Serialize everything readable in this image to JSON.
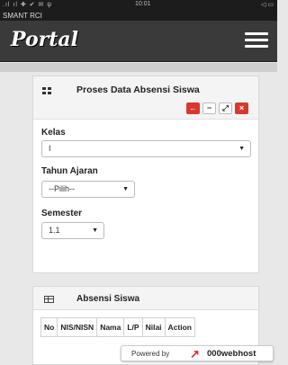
{
  "statusbar": {
    "left": ".ıl ıl ✚ ✔ ✉ ψ",
    "time": "10:01",
    "right": "◁ ▭"
  },
  "titlebar": {
    "text": "SMANT RCI"
  },
  "navbar": {
    "brand": "Portal"
  },
  "form_card": {
    "title": "Proses Data Absensi Siswa",
    "toolbar": {
      "back": "←",
      "minimize": "−",
      "expand": "⤢",
      "close": "×"
    },
    "kelas": {
      "label": "Kelas",
      "value": "I"
    },
    "tahun_ajaran": {
      "label": "Tahun Ajaran",
      "value": "--Pilih--"
    },
    "semester": {
      "label": "Semester",
      "value": "1.1"
    }
  },
  "table_card": {
    "title": "Absensi Siswa",
    "columns": [
      "No",
      "NIS/NISN",
      "Nama",
      "L/P",
      "Nilai",
      "Action"
    ]
  },
  "powered": {
    "text": "Powered by",
    "brand": "000webhost"
  }
}
